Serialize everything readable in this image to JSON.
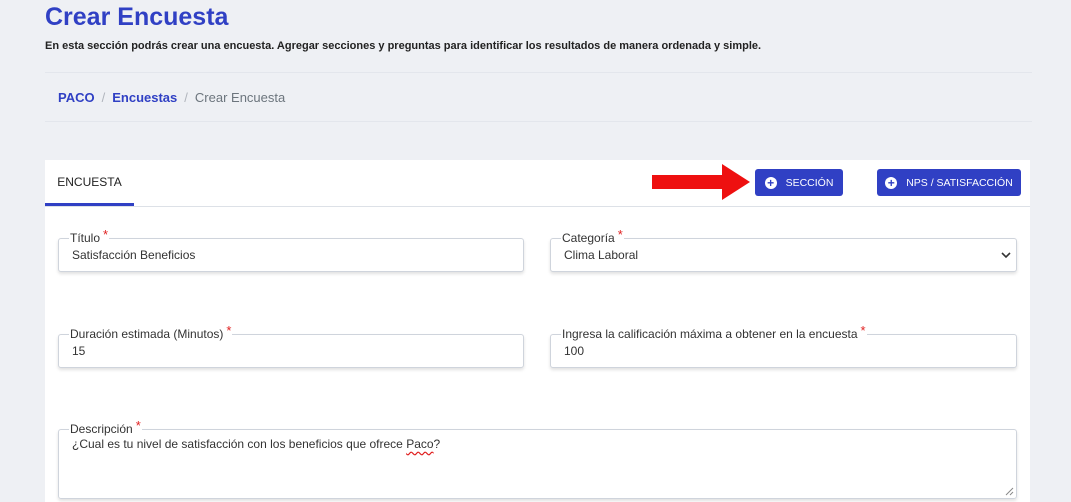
{
  "page": {
    "title": "Crear Encuesta",
    "subtitle": "En esta sección podrás crear una encuesta. Agregar secciones y preguntas para identificar los resultados de manera ordenada y simple."
  },
  "breadcrumb": {
    "items": [
      "PACO",
      "Encuestas",
      "Crear Encuesta"
    ],
    "separator": "/"
  },
  "tabs": [
    {
      "label": "ENCUESTA",
      "active": true
    }
  ],
  "toolbar": {
    "seccion_label": "SECCIÓN",
    "nps_label": "NPS / SATISFACCIÓN",
    "button_icon": "plus-circle-icon",
    "annotation": "red-arrow-icon"
  },
  "form": {
    "titulo": {
      "label": "Título",
      "value": "Satisfacción Beneficios",
      "required": true
    },
    "categoria": {
      "label": "Categoría",
      "value": "Clima Laboral",
      "required": true
    },
    "duracion": {
      "label": "Duración estimada (Minutos)",
      "value": "15",
      "required": true
    },
    "calificacion": {
      "label": "Ingresa la calificación máxima a obtener en la encuesta",
      "value": "100",
      "required": true
    },
    "descripcion": {
      "label": "Descripción",
      "value_prefix": "¿Cual es tu nivel de satisfacción con los beneficios que ofrece ",
      "value_misspelled": "Paco",
      "value_suffix": "?",
      "required": true
    },
    "required_mark": "*"
  },
  "colors": {
    "primary": "#3040c4",
    "required": "#e02020",
    "background": "#eef0f4"
  }
}
